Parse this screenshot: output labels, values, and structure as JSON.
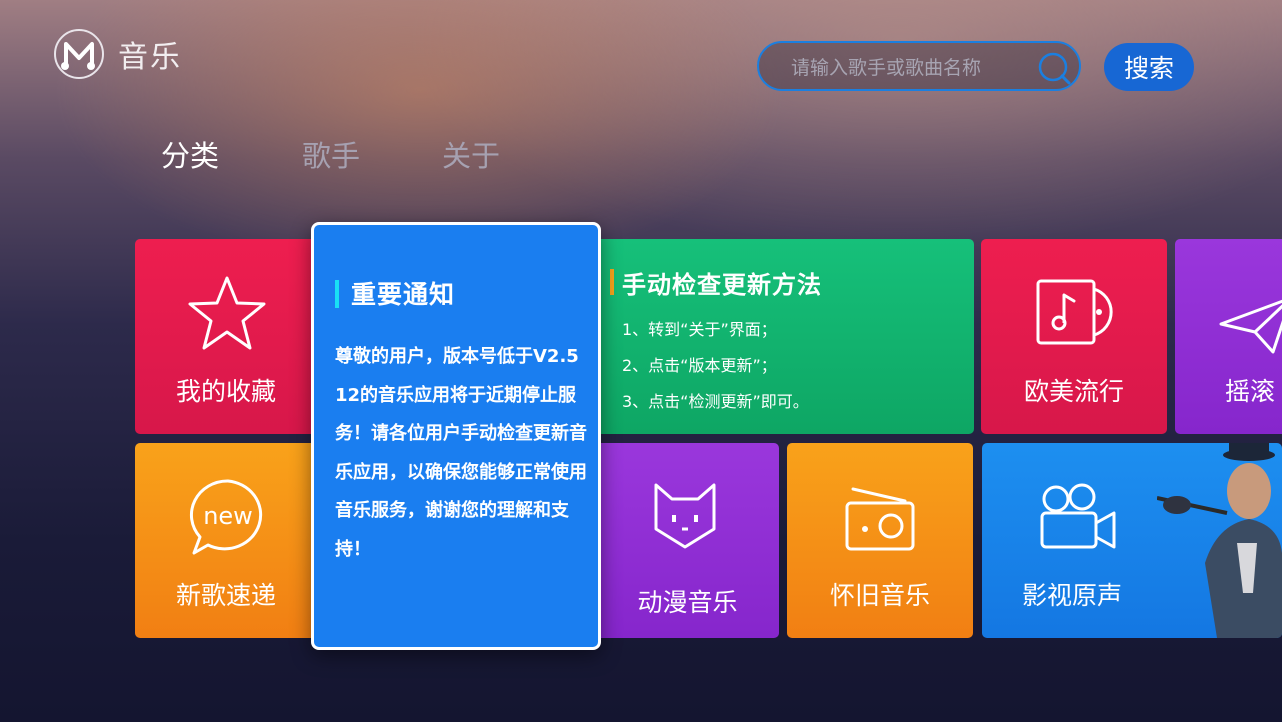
{
  "header": {
    "logo_icon": "music-note-logo-icon",
    "app_title": "音乐",
    "search": {
      "placeholder": "请输入歌手或歌曲名称",
      "value": "",
      "icon": "search-icon"
    },
    "search_button_label": "搜索"
  },
  "tabs": [
    {
      "label": "分类",
      "active": true
    },
    {
      "label": "歌手",
      "active": false
    },
    {
      "label": "关于",
      "active": false
    }
  ],
  "tiles": {
    "favorites": {
      "label": "我的收藏",
      "icon": "star-icon",
      "color": "#e8194c"
    },
    "new_songs": {
      "label": "新歌速递",
      "icon": "new-badge-icon",
      "color": "#f58c16"
    },
    "western_pop": {
      "label": "欧美流行",
      "icon": "album-icon",
      "color": "#e8194c"
    },
    "rock": {
      "label": "摇滚",
      "icon": "paper-plane-icon",
      "color": "#8f2ed4"
    },
    "anime_music": {
      "label": "动漫音乐",
      "icon": "cat-face-icon",
      "color": "#8f2ed4"
    },
    "oldies": {
      "label": "怀旧音乐",
      "icon": "radio-icon",
      "color": "#f58c16"
    },
    "soundtrack": {
      "label": "影视原声",
      "icon": "movie-camera-icon",
      "color": "#1a82ea"
    }
  },
  "update_info": {
    "title": "手动检查更新方法",
    "steps": [
      "1、转到“关于”界面；",
      "2、点击“版本更新”；",
      "3、点击“检测更新”即可。"
    ]
  },
  "notice": {
    "title": "重要通知",
    "body": "尊敬的用户，版本号低于V2.512的音乐应用将于近期停止服务！请各位用户手动检查更新音乐应用，以确保您能够正常使用音乐服务，谢谢您的理解和支持！"
  }
}
